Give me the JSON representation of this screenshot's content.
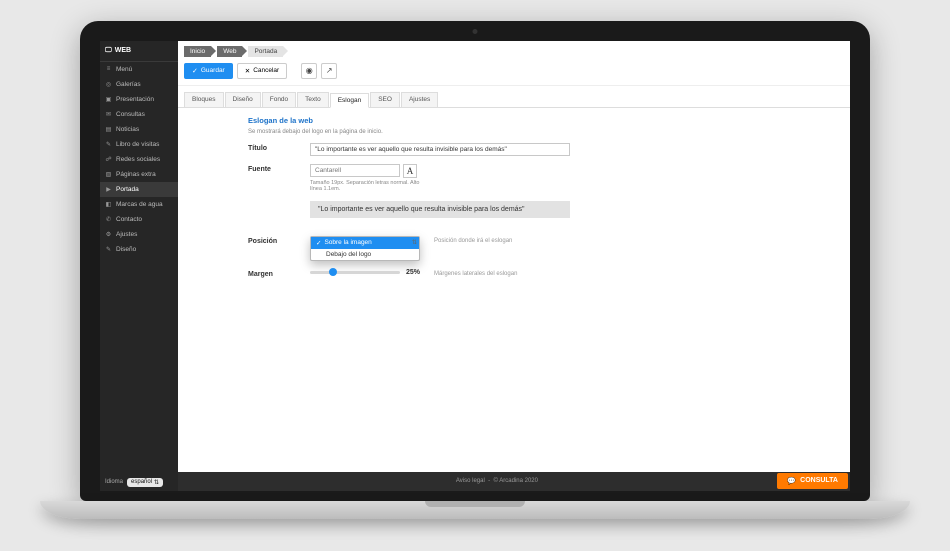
{
  "brand": "WEB",
  "sidebar": {
    "items": [
      {
        "icon": "≡",
        "label": "Menú"
      },
      {
        "icon": "◎",
        "label": "Galerías"
      },
      {
        "icon": "▣",
        "label": "Presentación"
      },
      {
        "icon": "✉",
        "label": "Consultas"
      },
      {
        "icon": "▤",
        "label": "Noticias"
      },
      {
        "icon": "✎",
        "label": "Libro de visitas"
      },
      {
        "icon": "☍",
        "label": "Redes sociales"
      },
      {
        "icon": "▧",
        "label": "Páginas extra"
      },
      {
        "icon": "▶",
        "label": "Portada",
        "active": true
      },
      {
        "icon": "◧",
        "label": "Marcas de agua"
      },
      {
        "icon": "✆",
        "label": "Contacto"
      },
      {
        "icon": "⚙",
        "label": "Ajustes"
      },
      {
        "icon": "✎",
        "label": "Diseño"
      }
    ],
    "lang_label": "Idioma",
    "lang_value": "español"
  },
  "breadcrumb": [
    "Inicio",
    "Web",
    "Portada"
  ],
  "toolbar": {
    "save": "Guardar",
    "cancel": "Cancelar"
  },
  "tabs": [
    "Bloques",
    "Diseño",
    "Fondo",
    "Texto",
    "Eslogan",
    "SEO",
    "Ajustes"
  ],
  "active_tab": "Eslogan",
  "form": {
    "section_title": "Eslogan de la web",
    "section_hint": "Se mostrará debajo del logo en la página de inicio.",
    "titulo_label": "Título",
    "titulo_value": "\"Lo importante es ver aquello que resulta invisible para los demás\"",
    "fuente_label": "Fuente",
    "fuente_value": "Cantarell",
    "fuente_hint": "Tamaño 19px. Separación letras normal. Alto línea 1.1em.",
    "preview_text": "\"Lo importante es ver aquello que resulta invisible para los demás\"",
    "posicion_label": "Posición",
    "posicion_options": [
      "Sobre la imagen",
      "Debajo del logo"
    ],
    "posicion_selected": "Sobre la imagen",
    "posicion_hint": "Posición donde irá el eslogan",
    "margen_label": "Margen",
    "margen_value": "25%",
    "margen_hint": "Márgenes laterales del eslogan"
  },
  "footer": {
    "legal": "Aviso legal",
    "copyright": "© Arcadina 2020"
  },
  "consulta_button": "CONSULTA"
}
